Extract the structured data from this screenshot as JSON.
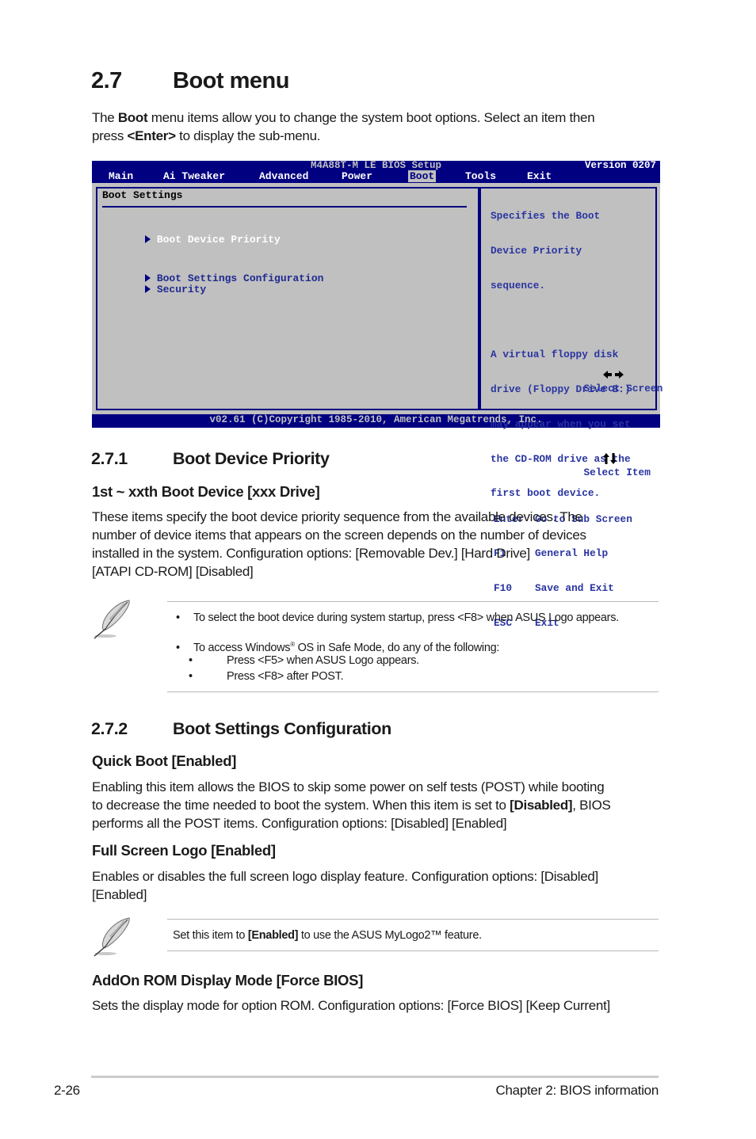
{
  "section": {
    "number": "2.7",
    "title": "Boot menu",
    "intro": {
      "pre": "The ",
      "bold1": "Boot",
      "mid": " menu items allow you to change the system boot options. Select an item then",
      "line2_pre": "press ",
      "bold2": "<Enter>",
      "line2_post": " to display the sub-menu."
    }
  },
  "bios": {
    "title": "M4A88T-M LE BIOS Setup",
    "version": "Version 0207",
    "menu": [
      {
        "label": "Main",
        "active": false
      },
      {
        "label": "Ai Tweaker",
        "active": false
      },
      {
        "label": "Advanced",
        "active": false
      },
      {
        "label": "Power",
        "active": false
      },
      {
        "label": "Boot",
        "active": true
      },
      {
        "label": "Tools",
        "active": false
      },
      {
        "label": "Exit",
        "active": false
      }
    ],
    "section_title": "Boot Settings",
    "items": [
      {
        "label": "Boot Device Priority",
        "selected": true
      },
      {
        "label": "Boot Settings Configuration",
        "selected": false
      },
      {
        "label": "Security",
        "selected": false
      }
    ],
    "help_lines": [
      "Specifies the Boot",
      "Device Priority",
      "sequence.",
      "",
      "A virtual floppy disk",
      "drive (Floppy Drive B:)",
      "may appear when you set",
      "the CD-ROM drive as the",
      "first boot device."
    ],
    "keys": [
      {
        "key": "left-right-arrows-icon",
        "desc": "Select Screen"
      },
      {
        "key": "up-down-arrows-icon",
        "desc": "Select Item"
      },
      {
        "key": "Enter",
        "desc": "Go to Sub Screen"
      },
      {
        "key": "F1",
        "desc": "General Help"
      },
      {
        "key": "F10",
        "desc": "Save and Exit"
      },
      {
        "key": "ESC",
        "desc": "Exit"
      }
    ],
    "footer": "v02.61 (C)Copyright 1985-2010, American Megatrends, Inc.",
    "colors": {
      "blue": "#000080",
      "gray": "#c0c0c0",
      "text_blue": "#2a35a0"
    }
  },
  "s271": {
    "number": "2.7.1",
    "title": "Boot Device Priority",
    "item_title": "1st ~ xxth Boot Device [xxx Drive]",
    "lines": [
      "These items specify the boot device priority sequence from the available devices. The",
      "number of device items that appears on the screen depends on the number of devices",
      "installed in the system. Configuration options: [Removable Dev.] [Hard Drive]",
      "[ATAPI CD-ROM] [Disabled]"
    ]
  },
  "note1": {
    "icon": "feather-pen-icon",
    "bullet1": "To select the boot device during system startup, press <F8> when ASUS Logo appears.",
    "bullet2_pre": "To access Windows",
    "bullet2_sup": "®",
    "bullet2_post": " OS in Safe Mode, do any of the following:",
    "sub1": "Press <F5> when ASUS Logo appears.",
    "sub2": "Press <F8> after POST.",
    "bullet_char": "•"
  },
  "s272": {
    "number": "2.7.2",
    "title": "Boot Settings Configuration",
    "quick_boot": {
      "title": "Quick Boot [Enabled]",
      "line1": "Enabling this item allows the BIOS to skip some power on self tests (POST) while booting",
      "line2_pre": "to decrease the time needed to boot the system. When this item is set to ",
      "line2_bold": "[Disabled]",
      "line2_post": ", BIOS",
      "line3": "performs all the POST items. Configuration options: [Disabled] [Enabled]"
    },
    "full_screen_logo": {
      "title": "Full Screen Logo [Enabled]",
      "line1": "Enables or disables the full screen logo display feature. Configuration options: [Disabled]",
      "line2": "[Enabled]"
    },
    "addon_rom": {
      "title": "AddOn ROM Display Mode [Force BIOS]",
      "line1": "Sets the display mode for option ROM. Configuration options: [Force BIOS] [Keep Current]"
    }
  },
  "note2": {
    "icon": "feather-pen-icon",
    "pre": "Set this item to ",
    "bold": "[Enabled]",
    "post": " to use the ASUS MyLogo2™ feature."
  },
  "footer": {
    "page": "2-26",
    "chapter": "Chapter 2: BIOS information"
  }
}
